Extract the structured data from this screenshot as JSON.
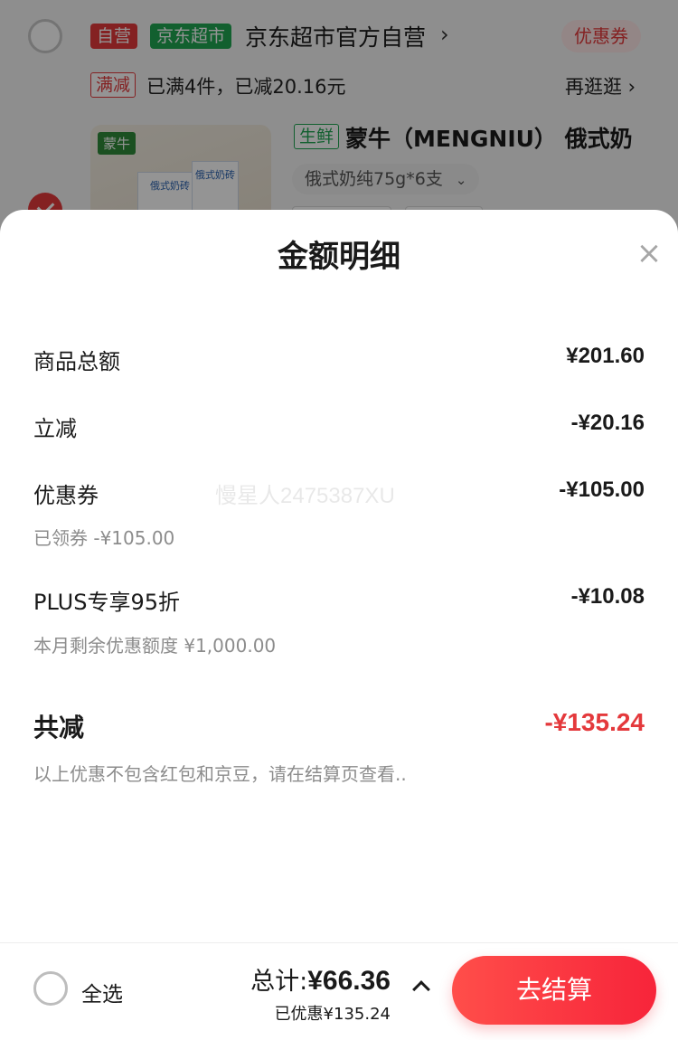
{
  "cart": {
    "store": {
      "tag_ziying": "自营",
      "tag_jd": "京东超市",
      "name": "京东超市官方自营",
      "chevron": "›",
      "coupon": "优惠券"
    },
    "promo": {
      "tag": "满减",
      "text": "已满4件，已减20.16元",
      "link": "再逛逛 ›"
    },
    "product": {
      "brand_logo": "蒙牛",
      "box_text_1": "俄式奶砖",
      "box_text_2": "俄式奶砖",
      "fresh_tag": "生鲜",
      "title": "蒙牛（MENGNIU） 俄式奶",
      "spec": "俄式奶纯75g*6支",
      "spec_chevron": "⌄"
    }
  },
  "sheet": {
    "title": "金额明细",
    "close_icon": "×",
    "rows": [
      {
        "label": "商品总额",
        "value": "¥201.60"
      },
      {
        "label": "立减",
        "value": "-¥20.16"
      },
      {
        "label": "优惠券",
        "value": "-¥105.00",
        "sub": "已领券 -¥105.00"
      },
      {
        "label": "PLUS专享95折",
        "value": "-¥10.08",
        "sub": "本月剩余优惠额度 ¥1,000.00"
      }
    ],
    "watermark": "慢星人2475387XU",
    "total_label": "共减",
    "total_value": "-¥135.24",
    "note": "以上优惠不包含红包和京豆，请在结算页查看.."
  },
  "bottom_bar": {
    "select_all": "全选",
    "sum_label": "总计:",
    "sum_value": "¥66.36",
    "saved": "已优惠¥135.24",
    "checkout": "去结算"
  },
  "colors": {
    "accent_red": "#e4393c",
    "jd_green": "#1fa552",
    "text_dark": "#1a1a1a",
    "text_gray": "#8c8c8c"
  },
  "icons": {
    "close": "close-icon",
    "expand": "chevron-up-icon",
    "store_chevron": "chevron-right-icon"
  }
}
